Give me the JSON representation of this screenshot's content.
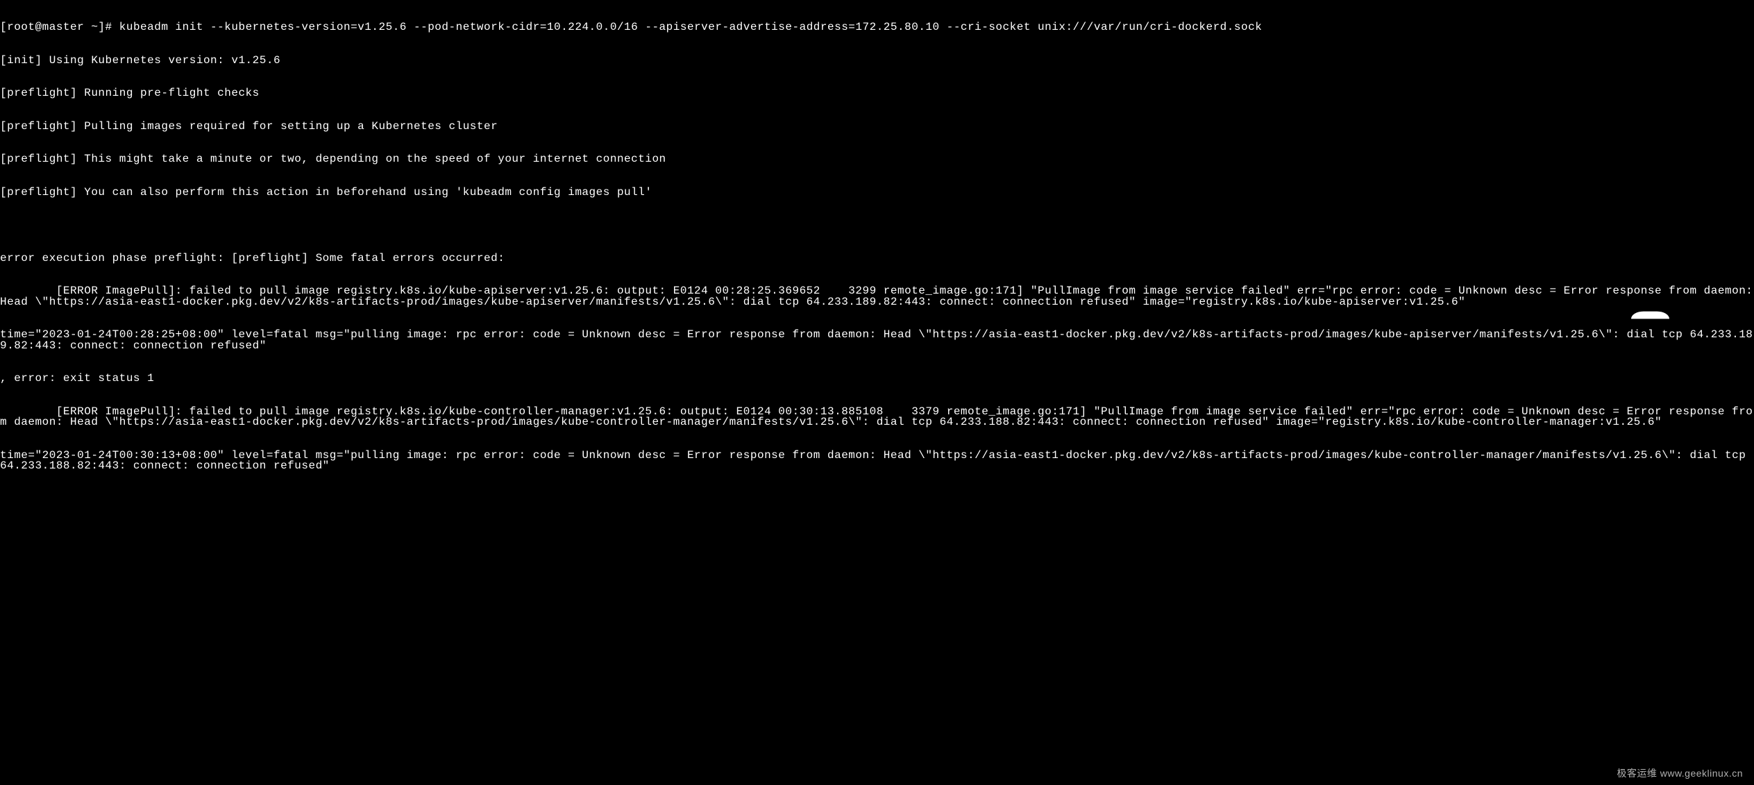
{
  "prompt": {
    "user_host": "[root@master ~]#",
    "command": "kubeadm init --kubernetes-version=v1.25.6 --pod-network-cidr=10.224.0.0/16 --apiserver-advertise-address=172.25.80.10 --cri-socket unix:///var/run/cri-dockerd.sock"
  },
  "lines": [
    "[init] Using Kubernetes version: v1.25.6",
    "[preflight] Running pre-flight checks",
    "[preflight] Pulling images required for setting up a Kubernetes cluster",
    "[preflight] This might take a minute or two, depending on the speed of your internet connection",
    "[preflight] You can also perform this action in beforehand using 'kubeadm config images pull'",
    "",
    "error execution phase preflight: [preflight] Some fatal errors occurred:",
    "        [ERROR ImagePull]: failed to pull image registry.k8s.io/kube-apiserver:v1.25.6: output: E0124 00:28:25.369652    3299 remote_image.go:171] \"PullImage from image service failed\" err=\"rpc error: code = Unknown desc = Error response from daemon: Head \\\"https://asia-east1-docker.pkg.dev/v2/k8s-artifacts-prod/images/kube-apiserver/manifests/v1.25.6\\\": dial tcp 64.233.189.82:443: connect: connection refused\" image=\"registry.k8s.io/kube-apiserver:v1.25.6\"",
    "time=\"2023-01-24T00:28:25+08:00\" level=fatal msg=\"pulling image: rpc error: code = Unknown desc = Error response from daemon: Head \\\"https://asia-east1-docker.pkg.dev/v2/k8s-artifacts-prod/images/kube-apiserver/manifests/v1.25.6\\\": dial tcp 64.233.189.82:443: connect: connection refused\"",
    ", error: exit status 1",
    "        [ERROR ImagePull]: failed to pull image registry.k8s.io/kube-controller-manager:v1.25.6: output: E0124 00:30:13.885108    3379 remote_image.go:171] \"PullImage from image service failed\" err=\"rpc error: code = Unknown desc = Error response from daemon: Head \\\"https://asia-east1-docker.pkg.dev/v2/k8s-artifacts-prod/images/kube-controller-manager/manifests/v1.25.6\\\": dial tcp 64.233.188.82:443: connect: connection refused\" image=\"registry.k8s.io/kube-controller-manager:v1.25.6\"",
    "time=\"2023-01-24T00:30:13+08:00\" level=fatal msg=\"pulling image: rpc error: code = Unknown desc = Error response from daemon: Head \\\"https://asia-east1-docker.pkg.dev/v2/k8s-artifacts-prod/images/kube-controller-manager/manifests/v1.25.6\\\": dial tcp 64.233.188.82:443: connect: connection refused\""
  ],
  "watermark": "极客运维 www.geeklinux.cn"
}
